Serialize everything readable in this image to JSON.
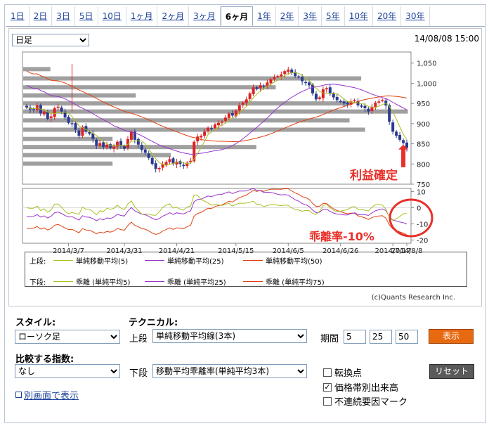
{
  "tabs": [
    "1日",
    "2日",
    "3日",
    "5日",
    "10日",
    "1ヶ月",
    "2ヶ月",
    "3ヶ月",
    "6ヶ月",
    "1年",
    "2年",
    "3年",
    "5年",
    "10年",
    "20年",
    "30年"
  ],
  "active_tab": "6ヶ月",
  "period_select": "日足",
  "timestamp": "14/08/08 15:00",
  "annotations": {
    "profit": "利益確定",
    "deviation": "乖離率-10%"
  },
  "colors": {
    "sma5": "#a8c020",
    "sma25": "#9933cc",
    "sma50": "#e04010",
    "dev5": "#a8c020",
    "dev25": "#9933cc",
    "dev75": "#e04010",
    "up": "#dd2222",
    "down": "#2a3a90",
    "volume": "#a0a0a0",
    "note": "#e8302a"
  },
  "legend": {
    "upper_label": "上段:",
    "lower_label": "下段:",
    "upper": [
      "単純移動平均(5)",
      "単純移動平均(25)",
      "単純移動平均(50)"
    ],
    "lower": [
      "乖離 (単純平均5)",
      "乖離 (単純平均25)",
      "乖離 (単純平均75)"
    ]
  },
  "copyright": "(c)Quants Research Inc.",
  "controls": {
    "style_label": "スタイル:",
    "style_value": "ローソク足",
    "technical_label": "テクニカル:",
    "upper_label": "上段",
    "upper_value": "単純移動平均線(3本)",
    "period_label": "期間",
    "periods": [
      "5",
      "25",
      "50"
    ],
    "show_button": "表示",
    "compare_label": "比較する指数:",
    "compare_value": "なし",
    "lower_label": "下段",
    "lower_value": "移動平均乖離率(単純平均3本)",
    "reset_button": "リセット",
    "checkboxes": [
      {
        "label": "転換点",
        "checked": false
      },
      {
        "label": "価格帯別出来高",
        "checked": true
      },
      {
        "label": "不連続要因マーク",
        "checked": false
      }
    ],
    "new_window_link": "別画面で表示"
  },
  "chart_data": {
    "type": "candlestick",
    "x_ticks": [
      "2014/3/7",
      "2014/3/31",
      "2014/4/21",
      "2014/5/15",
      "2014/6/5",
      "2014/6/26",
      "2014/7/17",
      "2014/8/8"
    ],
    "upper_ylim": [
      750,
      1060
    ],
    "upper_y_ticks": [
      "1,050",
      "1,000",
      "950",
      "900",
      "850",
      "800",
      "750"
    ],
    "lower_ylim": [
      -22,
      12
    ],
    "lower_y_ticks": [
      "10",
      "0",
      "-10",
      "-20"
    ],
    "close": [
      940,
      935,
      935,
      945,
      925,
      930,
      912,
      918,
      938,
      942,
      930,
      915,
      902,
      900,
      885,
      870,
      892,
      880,
      875,
      862,
      845,
      852,
      842,
      848,
      840,
      843,
      855,
      845,
      838,
      862,
      880,
      860,
      848,
      835,
      828,
      815,
      800,
      788,
      790,
      800,
      805,
      812,
      800,
      806,
      800,
      795,
      803,
      808,
      855,
      868,
      870,
      880,
      890,
      888,
      898,
      902,
      905,
      915,
      925,
      920,
      932,
      945,
      952,
      960,
      975,
      990,
      986,
      995,
      992,
      1002,
      1010,
      1015,
      1018,
      1022,
      1030,
      1034,
      1026,
      1018,
      1015,
      1005,
      1002,
      995,
      975,
      960,
      965,
      985,
      988,
      975,
      965,
      958,
      955,
      950,
      948,
      955,
      958,
      945,
      942,
      938,
      930,
      942,
      952,
      955,
      958,
      945,
      905,
      880,
      870,
      860,
      852,
      840
    ],
    "volume_profile": [
      {
        "price": 1035,
        "length": 0.07
      },
      {
        "price": 1012,
        "length": 0.87
      },
      {
        "price": 990,
        "length": 0.65
      },
      {
        "price": 970,
        "length": 0.29
      },
      {
        "price": 950,
        "length": 0.84
      },
      {
        "price": 930,
        "length": 0.99
      },
      {
        "price": 908,
        "length": 0.84
      },
      {
        "price": 885,
        "length": 0.88
      },
      {
        "price": 862,
        "length": 0.23
      },
      {
        "price": 842,
        "length": 0.6
      },
      {
        "price": 822,
        "length": 0.38
      },
      {
        "price": 801,
        "length": 0.23
      }
    ]
  }
}
